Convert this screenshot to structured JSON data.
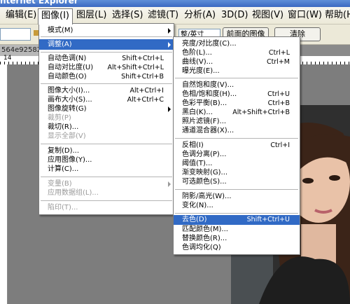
{
  "window_title": "nternet Explorer",
  "menubar": [
    {
      "label": "编辑(E)"
    },
    {
      "label": "图像(I)"
    },
    {
      "label": "图层(L)"
    },
    {
      "label": "选择(S)"
    },
    {
      "label": "滤镜(T)"
    },
    {
      "label": "分析(A)"
    },
    {
      "label": "3D(D)"
    },
    {
      "label": "视图(V)"
    },
    {
      "label": "窗口(W)"
    },
    {
      "label": "帮助(H)"
    }
  ],
  "options_bar": {
    "combo_value": "整/英寸",
    "front_image_button": "前面的图像",
    "clear_button": "清除"
  },
  "document_tab": "564e92582",
  "ruler_number": "14",
  "image_menu": [
    {
      "label": "模式(M)",
      "shortcut": "",
      "submenu": true
    },
    {
      "label": "调整(A)",
      "shortcut": "",
      "submenu": true,
      "highlighted": true
    },
    {
      "label": "自动色调(N)",
      "shortcut": "Shift+Ctrl+L"
    },
    {
      "label": "自动对比度(U)",
      "shortcut": "Alt+Shift+Ctrl+L"
    },
    {
      "label": "自动颜色(O)",
      "shortcut": "Shift+Ctrl+B"
    },
    {
      "label": "图像大小(I)...",
      "shortcut": "Alt+Ctrl+I"
    },
    {
      "label": "画布大小(S)...",
      "shortcut": "Alt+Ctrl+C"
    },
    {
      "label": "图像旋转(G)",
      "shortcut": "",
      "submenu": true
    },
    {
      "label": "裁剪(P)",
      "shortcut": "",
      "disabled": true
    },
    {
      "label": "裁切(R)...",
      "shortcut": ""
    },
    {
      "label": "显示全部(V)",
      "shortcut": "",
      "disabled": true
    },
    {
      "label": "复制(D)...",
      "shortcut": ""
    },
    {
      "label": "应用图像(Y)...",
      "shortcut": ""
    },
    {
      "label": "计算(C)...",
      "shortcut": ""
    },
    {
      "label": "变量(B)",
      "shortcut": "",
      "submenu": true,
      "disabled": true
    },
    {
      "label": "应用数据组(L)...",
      "shortcut": "",
      "disabled": true
    },
    {
      "label": "陷印(T)...",
      "shortcut": "",
      "disabled": true
    }
  ],
  "adjust_menu": [
    {
      "label": "亮度/对比度(C)...",
      "shortcut": ""
    },
    {
      "label": "色阶(L)...",
      "shortcut": "Ctrl+L"
    },
    {
      "label": "曲线(V)...",
      "shortcut": "Ctrl+M"
    },
    {
      "label": "曝光度(E)...",
      "shortcut": ""
    },
    {
      "label": "自然饱和度(V)...",
      "shortcut": ""
    },
    {
      "label": "色相/饱和度(H)...",
      "shortcut": "Ctrl+U"
    },
    {
      "label": "色彩平衡(B)...",
      "shortcut": "Ctrl+B"
    },
    {
      "label": "黑白(K)...",
      "shortcut": "Alt+Shift+Ctrl+B"
    },
    {
      "label": "照片滤镜(F)...",
      "shortcut": ""
    },
    {
      "label": "通道混合器(X)...",
      "shortcut": ""
    },
    {
      "label": "反相(I)",
      "shortcut": "Ctrl+I"
    },
    {
      "label": "色调分离(P)...",
      "shortcut": ""
    },
    {
      "label": "阈值(T)...",
      "shortcut": ""
    },
    {
      "label": "渐变映射(G)...",
      "shortcut": ""
    },
    {
      "label": "可选颜色(S)...",
      "shortcut": ""
    },
    {
      "label": "阴影/高光(W)...",
      "shortcut": ""
    },
    {
      "label": "变化(N)...",
      "shortcut": ""
    },
    {
      "label": "去色(D)",
      "shortcut": "Shift+Ctrl+U",
      "highlighted": true
    },
    {
      "label": "匹配颜色(M)...",
      "shortcut": ""
    },
    {
      "label": "替换颜色(R)...",
      "shortcut": ""
    },
    {
      "label": "色调均化(Q)",
      "shortcut": ""
    }
  ],
  "colors": {
    "highlight": "#316ac5",
    "menubar": "#ece9d8"
  }
}
